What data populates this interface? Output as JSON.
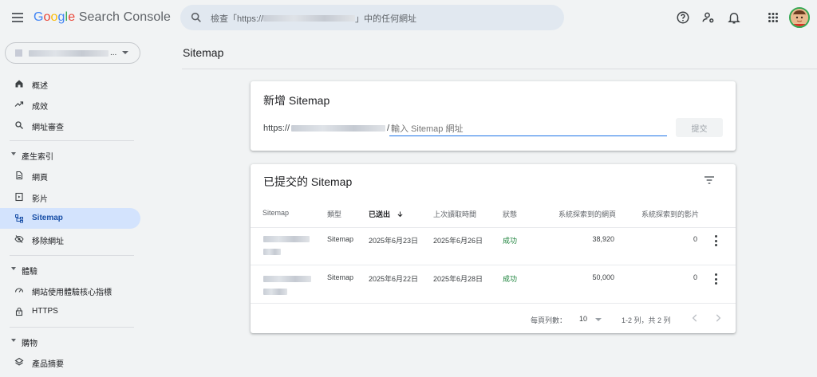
{
  "app": {
    "logo_google": "Google",
    "logo_product": "Search Console"
  },
  "search": {
    "placeholder_prefix": "檢查「https://",
    "placeholder_suffix": "」中的任何網址"
  },
  "header_icons": [
    "help-icon",
    "manage-accounts-icon",
    "notifications-icon",
    "apps-grid-icon",
    "account-avatar"
  ],
  "sidebar": {
    "items_top": [
      {
        "label": "概述",
        "icon": "home-icon"
      },
      {
        "label": "成效",
        "icon": "trending-icon"
      },
      {
        "label": "網址審查",
        "icon": "search-icon"
      }
    ],
    "section_index": "產生索引",
    "items_index": [
      {
        "label": "網頁",
        "icon": "page-icon"
      },
      {
        "label": "影片",
        "icon": "video-page-icon"
      },
      {
        "label": "Sitemap",
        "icon": "sitemap-icon",
        "active": true
      },
      {
        "label": "移除網址",
        "icon": "removals-icon"
      }
    ],
    "section_experience": "體驗",
    "items_experience": [
      {
        "label": "網站使用體驗核心指標",
        "icon": "speed-icon"
      },
      {
        "label": "HTTPS",
        "icon": "lock-icon"
      }
    ],
    "section_shopping": "購物",
    "items_shopping": [
      {
        "label": "產品摘要",
        "icon": "layers-icon"
      }
    ]
  },
  "main": {
    "page_title": "Sitemap",
    "add_card": {
      "title": "新增 Sitemap",
      "url_prefix": "https://",
      "url_slash": "/",
      "input_placeholder": "輸入 Sitemap 網址",
      "submit_label": "提交"
    },
    "submitted_card": {
      "title": "已提交的 Sitemap",
      "columns": [
        "Sitemap",
        "類型",
        "已送出",
        "上次讀取時間",
        "狀態",
        "系統探索到的網頁",
        "系統探索到的影片"
      ],
      "sorted_column": "已送出",
      "rows": [
        {
          "type": "Sitemap",
          "submitted": "2025年6月23日",
          "last_read": "2025年6月26日",
          "status": "成功",
          "pages": "38,920",
          "videos": "0"
        },
        {
          "type": "Sitemap",
          "submitted": "2025年6月22日",
          "last_read": "2025年6月28日",
          "status": "成功",
          "pages": "50,000",
          "videos": "0"
        }
      ],
      "pager": {
        "rows_per_page_label": "每頁列數：",
        "rows_per_page_value": "10",
        "range_label": "1-2 列，共 2 列"
      }
    }
  },
  "colors": {
    "accent": "#1a73e8",
    "active_nav_bg": "#d3e3fd",
    "success": "#188038",
    "background": "#f1f3f4"
  }
}
